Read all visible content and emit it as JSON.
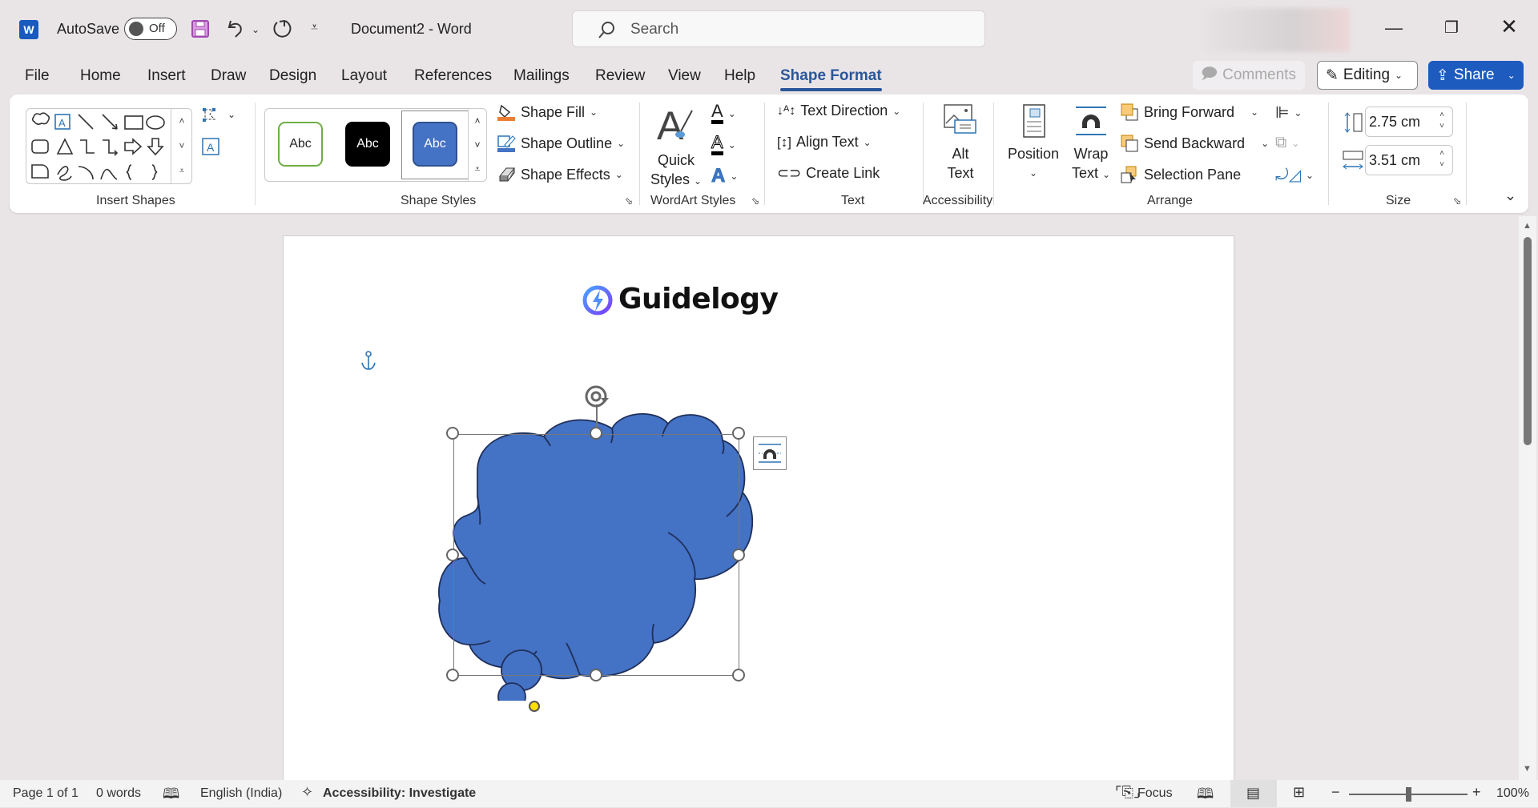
{
  "titlebar": {
    "autosave_label": "AutoSave",
    "autosave_state": "Off",
    "document_title": "Document2  -  Word",
    "search_placeholder": "Search"
  },
  "tabs": [
    {
      "label": "File"
    },
    {
      "label": "Home"
    },
    {
      "label": "Insert"
    },
    {
      "label": "Draw"
    },
    {
      "label": "Design"
    },
    {
      "label": "Layout"
    },
    {
      "label": "References"
    },
    {
      "label": "Mailings"
    },
    {
      "label": "Review"
    },
    {
      "label": "View"
    },
    {
      "label": "Help"
    },
    {
      "label": "Shape Format",
      "active": true
    }
  ],
  "top_actions": {
    "comments": "Comments",
    "editing": "Editing",
    "share": "Share"
  },
  "ribbon": {
    "insert_shapes": {
      "label": "Insert Shapes"
    },
    "shape_styles": {
      "label": "Shape Styles",
      "swatches": [
        "Abc",
        "Abc",
        "Abc"
      ],
      "shape_fill": "Shape Fill",
      "shape_outline": "Shape Outline",
      "shape_effects": "Shape Effects"
    },
    "wordart": {
      "label": "WordArt Styles",
      "quick_styles_1": "Quick",
      "quick_styles_2": "Styles"
    },
    "text": {
      "label": "Text",
      "text_direction": "Text Direction",
      "align_text": "Align Text",
      "create_link": "Create Link"
    },
    "accessibility": {
      "label": "Accessibility",
      "alt_text_1": "Alt",
      "alt_text_2": "Text"
    },
    "arrange": {
      "label": "Arrange",
      "position": "Position",
      "wrap_1": "Wrap",
      "wrap_2": "Text",
      "bring_forward": "Bring Forward",
      "send_backward": "Send Backward",
      "selection_pane": "Selection Pane"
    },
    "size": {
      "label": "Size",
      "height": "2.75 cm",
      "width": "3.51 cm"
    }
  },
  "document": {
    "logo_text": "Guidelogy",
    "shape_fill_color": "#4472c4",
    "shape_outline_color": "#1f2f5a"
  },
  "status": {
    "page": "Page 1 of 1",
    "words": "0 words",
    "language": "English (India)",
    "accessibility": "Accessibility: Investigate",
    "focus": "Focus",
    "zoom": "100%",
    "zoom_level_percent": 100
  }
}
